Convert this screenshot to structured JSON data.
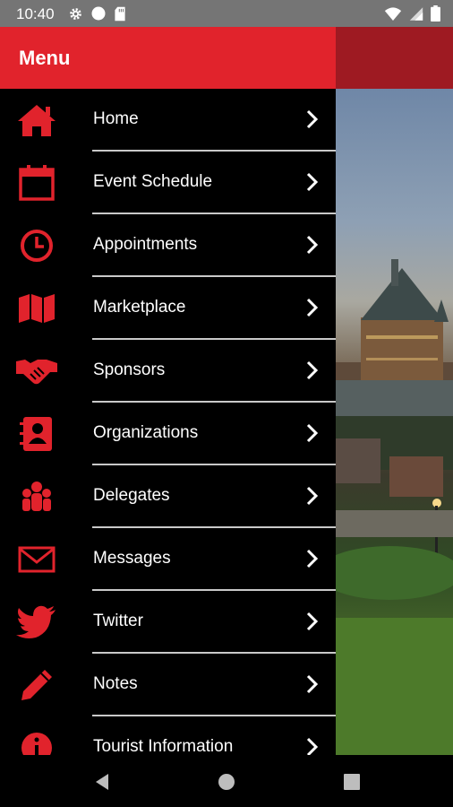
{
  "status_bar": {
    "time": "10:40",
    "left_icons": [
      "gear-icon",
      "circle-icon",
      "sd-card-icon"
    ],
    "right_icons": [
      "wifi-icon",
      "signal-icon",
      "battery-icon"
    ]
  },
  "drawer": {
    "title": "Menu",
    "accent_color": "#e1232c",
    "items": [
      {
        "label": "Home",
        "icon": "home-icon"
      },
      {
        "label": "Event Schedule",
        "icon": "calendar-icon"
      },
      {
        "label": "Appointments",
        "icon": "clock-icon"
      },
      {
        "label": "Marketplace",
        "icon": "map-icon"
      },
      {
        "label": "Sponsors",
        "icon": "handshake-icon"
      },
      {
        "label": "Organizations",
        "icon": "contact-book-icon"
      },
      {
        "label": "Delegates",
        "icon": "group-icon"
      },
      {
        "label": "Messages",
        "icon": "envelope-icon"
      },
      {
        "label": "Twitter",
        "icon": "twitter-bird-icon"
      },
      {
        "label": "Notes",
        "icon": "pencil-icon"
      },
      {
        "label": "Tourist Information",
        "icon": "info-icon"
      }
    ]
  },
  "nav_bar": {
    "buttons": [
      "back-button",
      "home-button",
      "recents-button"
    ]
  }
}
